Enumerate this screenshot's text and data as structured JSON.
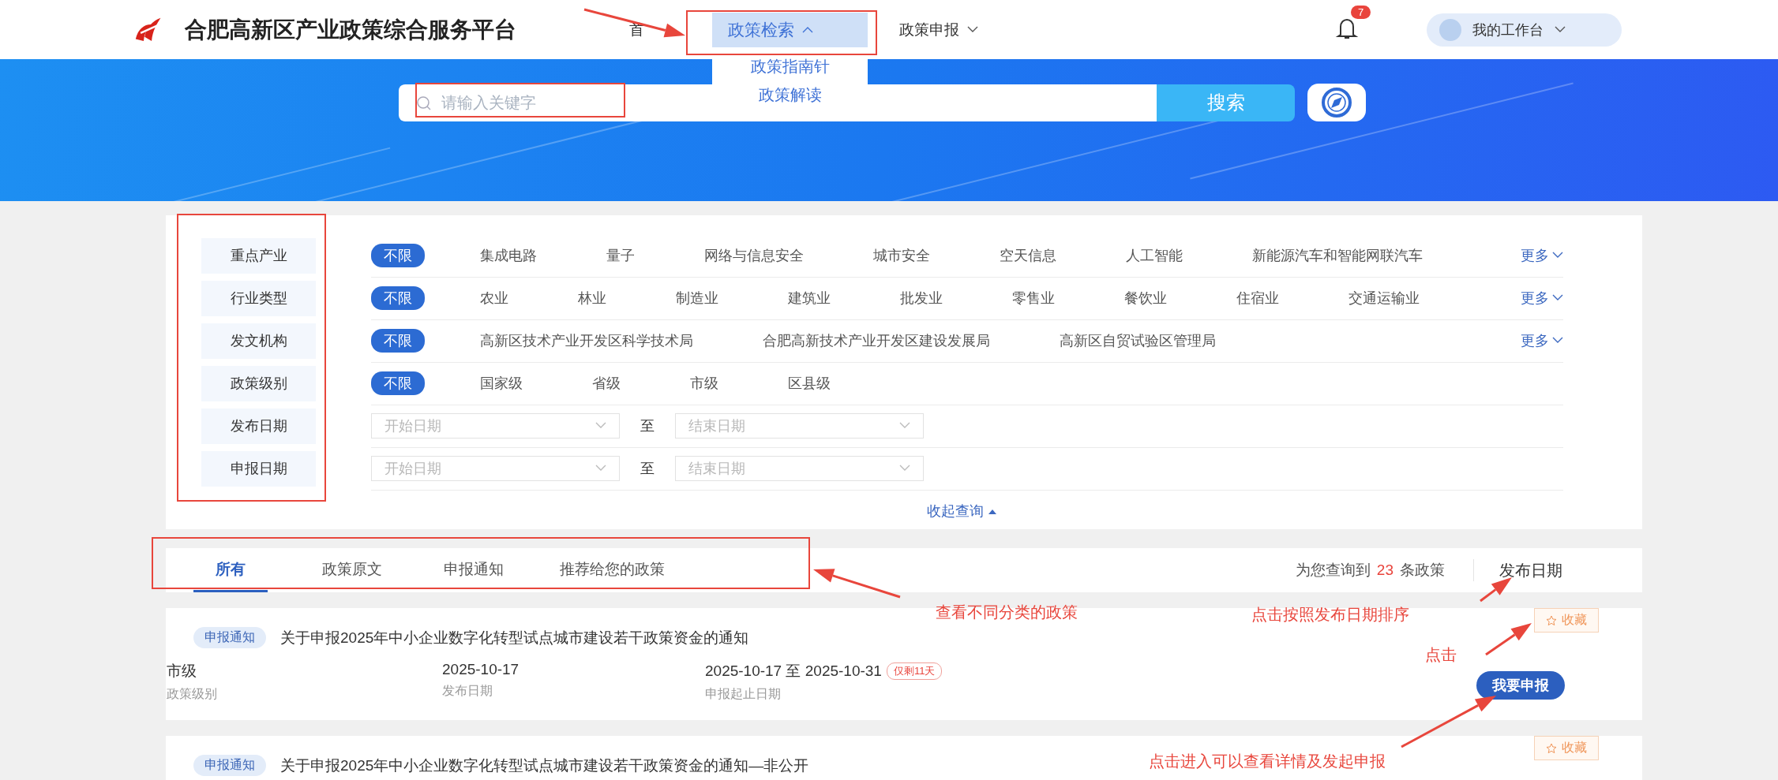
{
  "header": {
    "logo_text": "合肥高新区产业政策综合服务平台",
    "nav": [
      {
        "label": "首",
        "kind": "link",
        "selected": false
      },
      {
        "label": "政策检索",
        "kind": "dropdown",
        "selected": true,
        "expanded": true,
        "menu": [
          "政策指南针",
          "政策解读"
        ]
      },
      {
        "label": "政策申报",
        "kind": "dropdown",
        "selected": false,
        "expanded": false
      }
    ],
    "notification_count": "7",
    "workspace": "我的工作台"
  },
  "search": {
    "placeholder": "请输入关键字",
    "button": "搜索"
  },
  "filters": [
    {
      "label": "重点产业",
      "kind": "tags",
      "more": "更多",
      "options": [
        {
          "label": "不限",
          "selected": true
        },
        {
          "label": "集成电路",
          "selected": false
        },
        {
          "label": "量子",
          "selected": false
        },
        {
          "label": "网络与信息安全",
          "selected": false
        },
        {
          "label": "城市安全",
          "selected": false
        },
        {
          "label": "空天信息",
          "selected": false
        },
        {
          "label": "人工智能",
          "selected": false
        },
        {
          "label": "新能源汽车和智能网联汽车",
          "selected": false
        }
      ]
    },
    {
      "label": "行业类型",
      "kind": "tags",
      "more": "更多",
      "options": [
        {
          "label": "不限",
          "selected": true
        },
        {
          "label": "农业",
          "selected": false
        },
        {
          "label": "林业",
          "selected": false
        },
        {
          "label": "制造业",
          "selected": false
        },
        {
          "label": "建筑业",
          "selected": false
        },
        {
          "label": "批发业",
          "selected": false
        },
        {
          "label": "零售业",
          "selected": false
        },
        {
          "label": "餐饮业",
          "selected": false
        },
        {
          "label": "住宿业",
          "selected": false
        },
        {
          "label": "交通运输业",
          "selected": false
        }
      ]
    },
    {
      "label": "发文机构",
      "kind": "tags",
      "more": "更多",
      "options": [
        {
          "label": "不限",
          "selected": true
        },
        {
          "label": "高新区技术产业开发区科学技术局",
          "selected": false
        },
        {
          "label": "合肥高新技术产业开发区建设发展局",
          "selected": false
        },
        {
          "label": "高新区自贸试验区管理局",
          "selected": false
        }
      ]
    },
    {
      "label": "政策级别",
      "kind": "tags",
      "options": [
        {
          "label": "不限",
          "selected": true
        },
        {
          "label": "国家级",
          "selected": false
        },
        {
          "label": "省级",
          "selected": false
        },
        {
          "label": "市级",
          "selected": false
        },
        {
          "label": "区县级",
          "selected": false
        }
      ]
    },
    {
      "label": "发布日期",
      "kind": "date-range",
      "start_placeholder": "开始日期",
      "separator": "至",
      "end_placeholder": "结束日期"
    },
    {
      "label": "申报日期",
      "kind": "date-range",
      "start_placeholder": "开始日期",
      "separator": "至",
      "end_placeholder": "结束日期"
    }
  ],
  "collapse": "收起查询",
  "tabs": [
    {
      "label": "所有",
      "selected": true
    },
    {
      "label": "政策原文",
      "selected": false
    },
    {
      "label": "申报通知",
      "selected": false
    },
    {
      "label": "推荐给您的政策",
      "selected": false
    }
  ],
  "result_summary": {
    "prefix": "为您查询到",
    "count": "23",
    "suffix": "条政策"
  },
  "sort": "发布日期",
  "policies": [
    {
      "tag": "申报通知",
      "title": "关于申报2025年中小企业数字化转型试点城市建设若干政策资金的通知",
      "favorite": "收藏",
      "apply": "我要申报",
      "fields": [
        {
          "value": "市级",
          "label": "政策级别"
        },
        {
          "value": "2025-10-17",
          "label": "发布日期"
        },
        {
          "value": "2025-10-17 至 2025-10-31",
          "label": "申报起止日期",
          "badge": "仅剩11天"
        }
      ]
    },
    {
      "tag": "申报通知",
      "title": "关于申报2025年中小企业数字化转型试点城市建设若干政策资金的通知—非公开",
      "favorite": "收藏"
    }
  ],
  "annotations": [
    "查看不同分类的政策",
    "点击按照发布日期排序",
    "点击",
    "点击进入可以查看详情及发起申报"
  ]
}
